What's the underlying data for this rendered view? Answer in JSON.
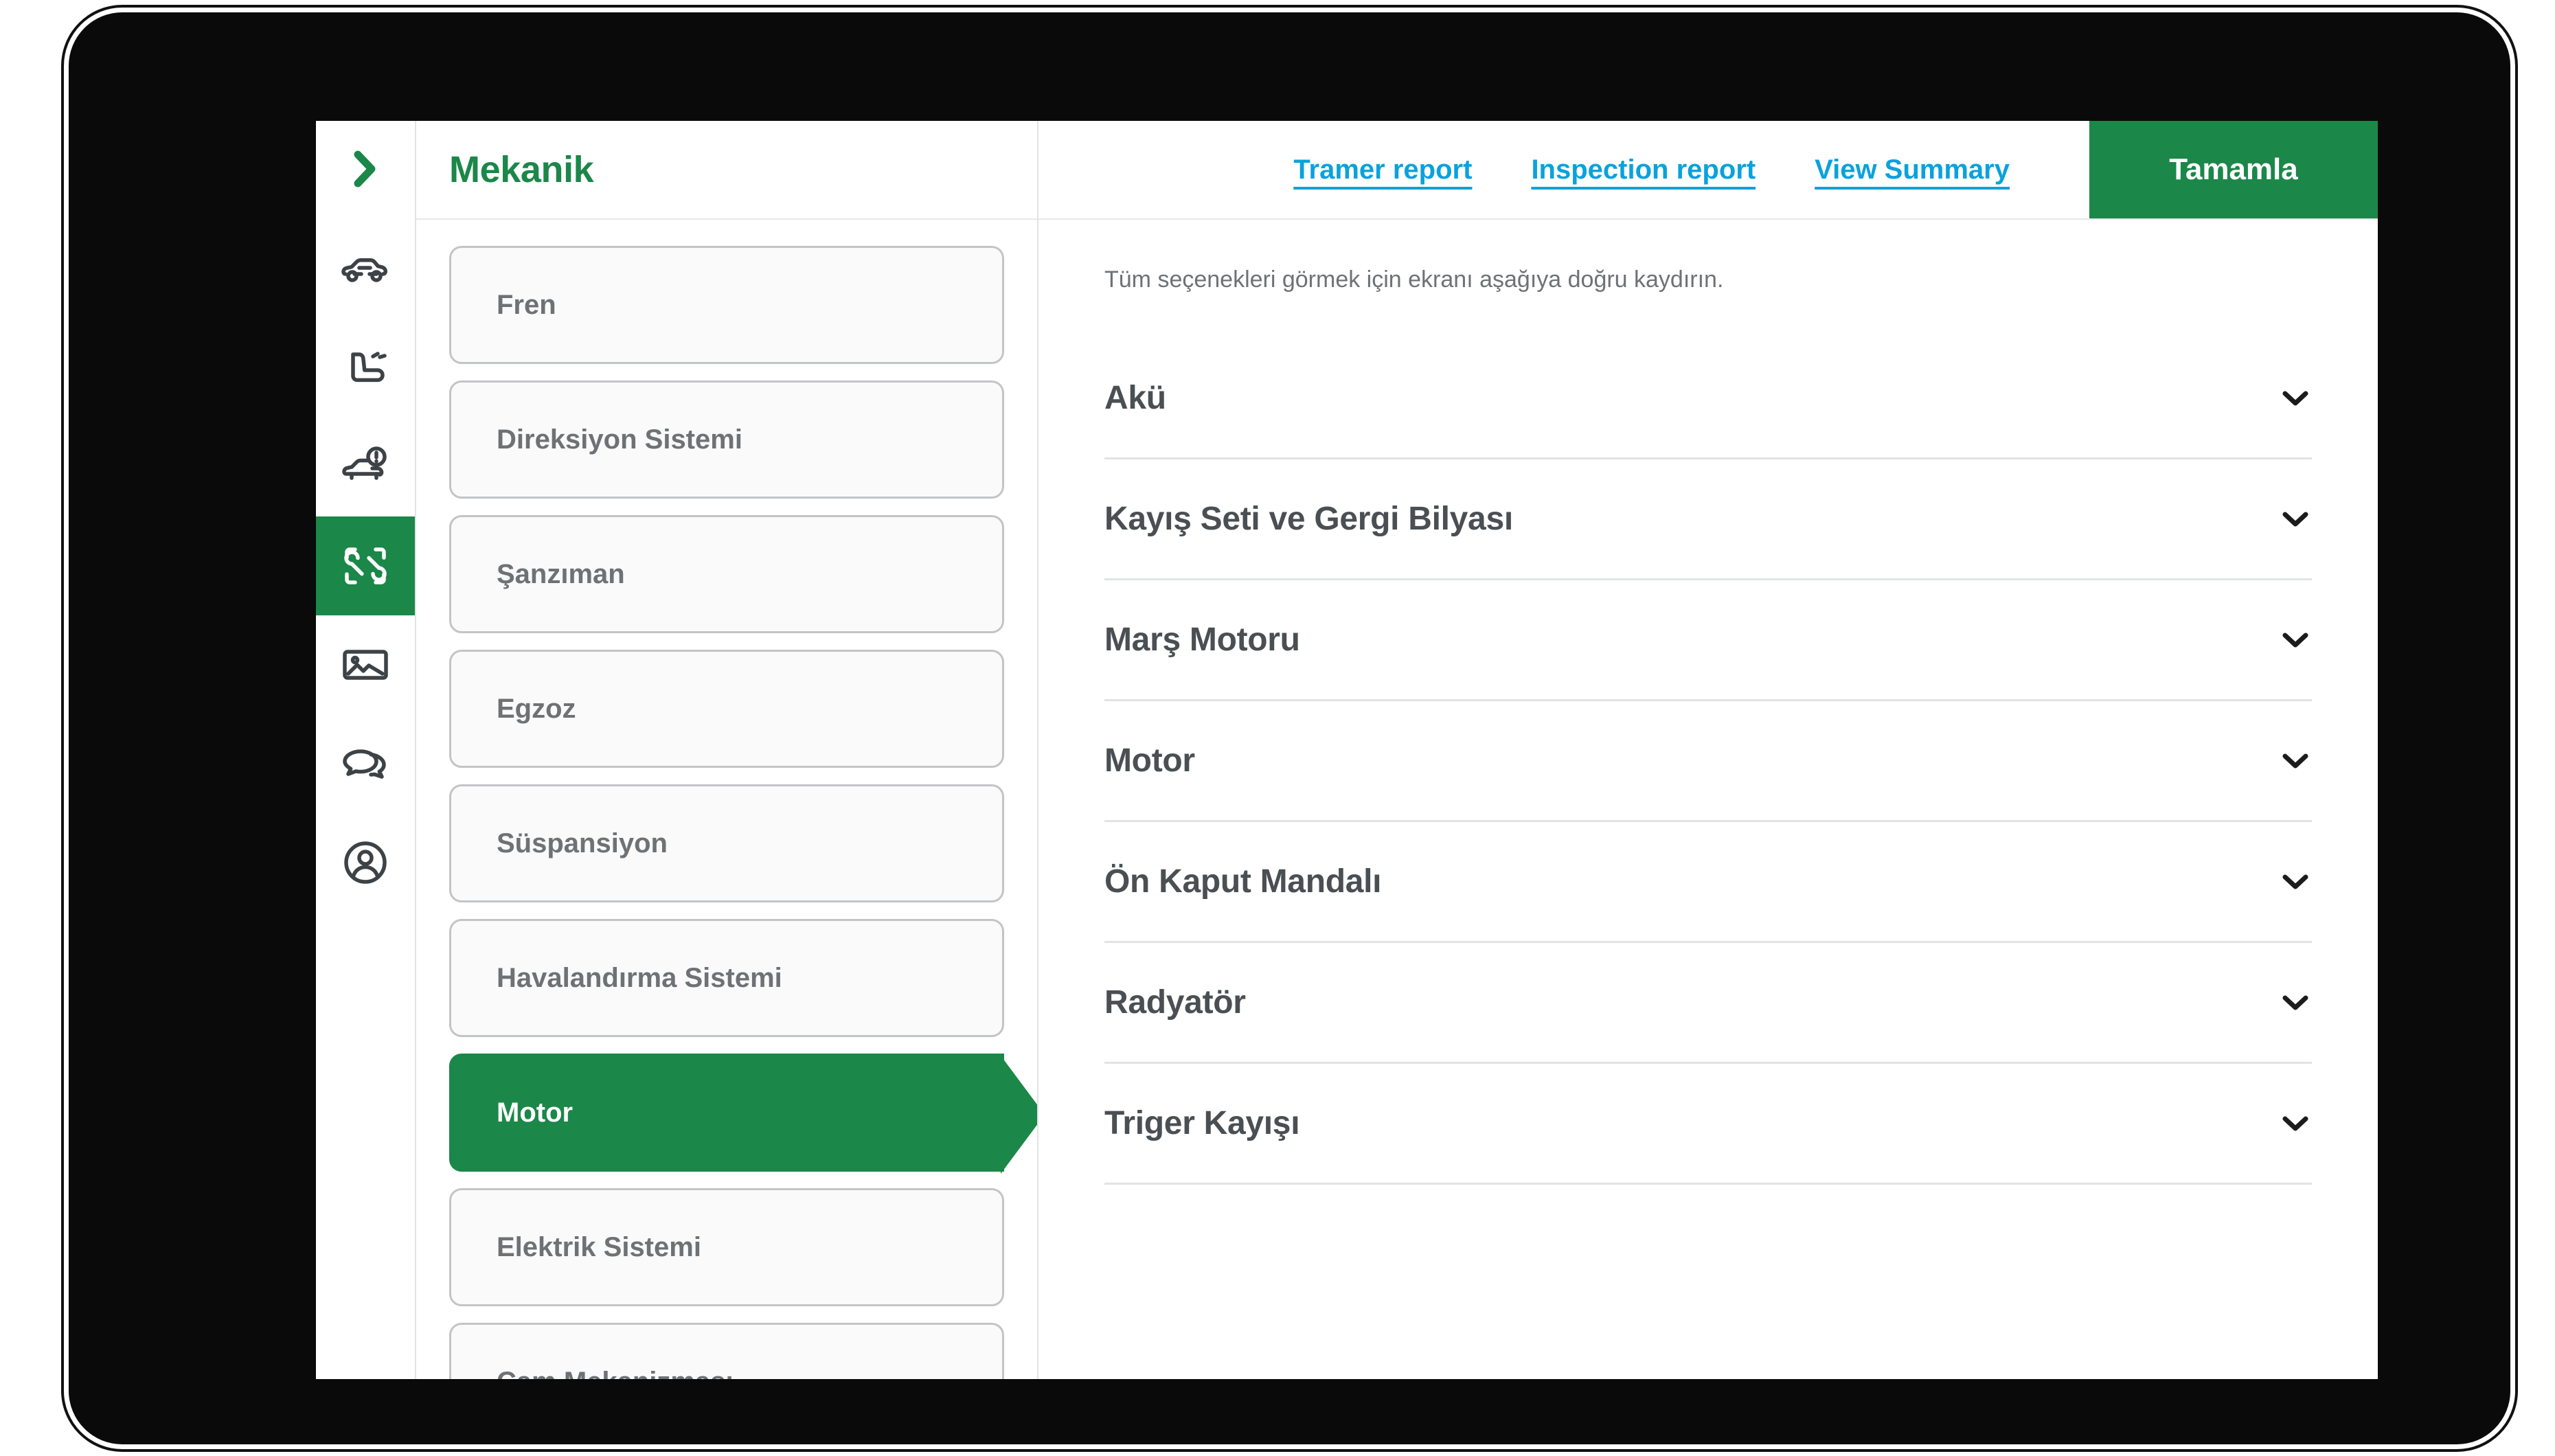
{
  "app": {
    "page_title": "Mekanik",
    "brand_green": "#1B8748",
    "link_blue": "#0AA2DC"
  },
  "rail": {
    "toggle_icon": "chevron-right-icon",
    "items": [
      {
        "icon": "car-icon",
        "active": false
      },
      {
        "icon": "car-seat-icon",
        "active": false
      },
      {
        "icon": "car-damage-alert-icon",
        "active": false
      },
      {
        "icon": "wrench-tools-icon",
        "active": true
      },
      {
        "icon": "image-photo-icon",
        "active": false
      },
      {
        "icon": "chat-bubbles-icon",
        "active": false
      },
      {
        "icon": "user-profile-icon",
        "active": false
      }
    ]
  },
  "topbar": {
    "links": [
      {
        "label": "Tramer report"
      },
      {
        "label": "Inspection report"
      },
      {
        "label": "View Summary"
      }
    ],
    "complete_label": "Tamamla"
  },
  "section_list": {
    "items": [
      {
        "label": "Fren",
        "active": false
      },
      {
        "label": "Direksiyon Sistemi",
        "active": false
      },
      {
        "label": "Şanzıman",
        "active": false
      },
      {
        "label": "Egzoz",
        "active": false
      },
      {
        "label": "Süspansiyon",
        "active": false
      },
      {
        "label": "Havalandırma Sistemi",
        "active": false
      },
      {
        "label": "Motor",
        "active": true
      },
      {
        "label": "Elektrik Sistemi",
        "active": false
      },
      {
        "label": "Cam Mekanizması",
        "active": false
      }
    ]
  },
  "detail": {
    "hint": "Tüm seçenekleri görmek için ekranı aşağıya doğru kaydırın.",
    "accordion": [
      {
        "label": "Akü",
        "expanded": false
      },
      {
        "label": "Kayış Seti ve Gergi Bilyası",
        "expanded": false
      },
      {
        "label": "Marş Motoru",
        "expanded": false
      },
      {
        "label": "Motor",
        "expanded": false
      },
      {
        "label": "Ön Kaput Mandalı",
        "expanded": false
      },
      {
        "label": "Radyatör",
        "expanded": false
      },
      {
        "label": "Triger Kayışı",
        "expanded": false
      }
    ]
  }
}
